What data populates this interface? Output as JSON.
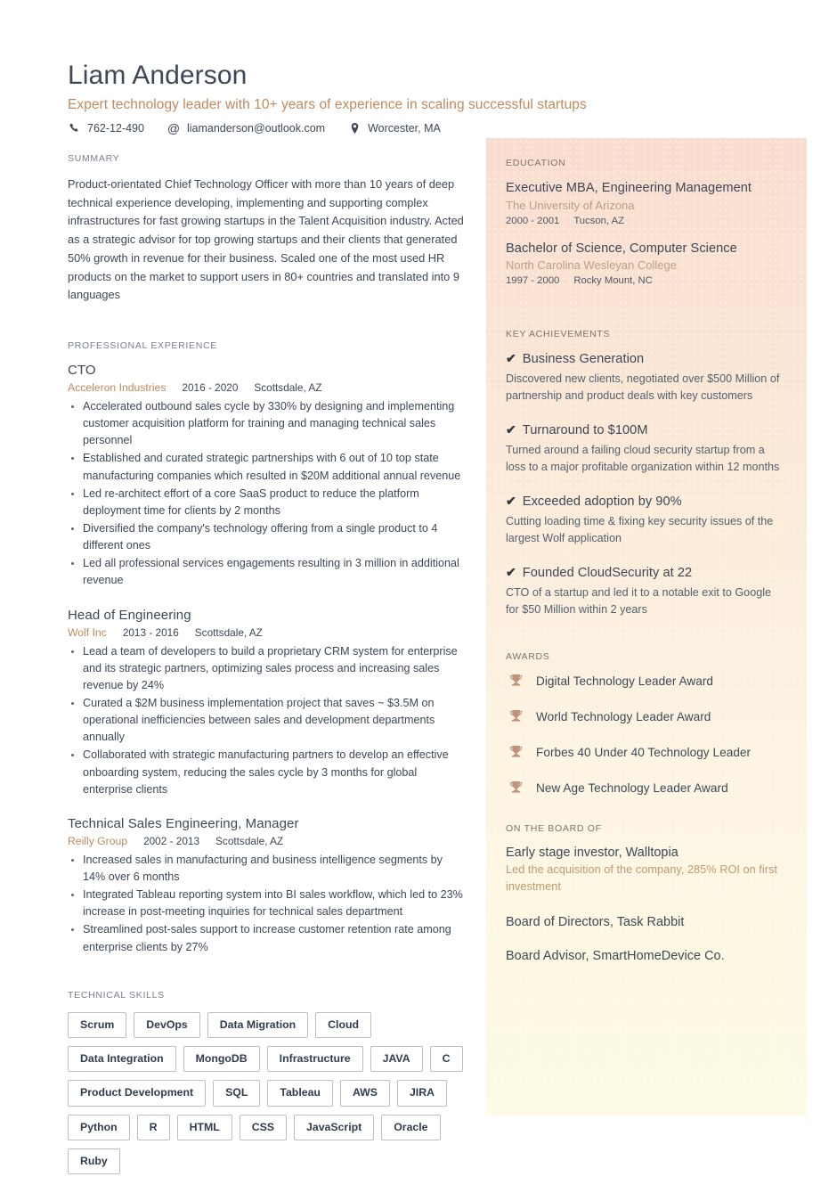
{
  "header": {
    "name": "Liam Anderson",
    "headline": "Expert technology leader with 10+ years of experience in scaling successful startups",
    "contact": {
      "phone": "762-12-490",
      "email": "liamanderson@outlook.com",
      "location": "Worcester, MA",
      "phone_icon": "phone-icon",
      "email_icon": "at-icon",
      "location_icon": "map-pin-icon"
    }
  },
  "colors": {
    "accent": "#c0895f",
    "text": "#3c4858",
    "label": "#78808c",
    "sidebar_top": "#f9ddcf",
    "sidebar_bottom": "#fdfbe3",
    "trophy": "#c2927a"
  },
  "summary": {
    "label": "SUMMARY",
    "text": "Product-orientated Chief Technology Officer with more than 10 years of deep technical experience developing, implementing and supporting complex infrastructures for fast growing startups in the Talent Acquisition industry. Acted as a strategic advisor for top growing startups and their clients that generated 50% growth in revenue for their business. Scaled one of the most used HR products on the market to support users in 80+ countries and translated into 9 languages"
  },
  "experience": {
    "label": "PROFESSIONAL EXPERIENCE",
    "jobs": [
      {
        "title": "CTO",
        "company": "Acceleron Industries",
        "dates": "2016 - 2020",
        "location": "Scottsdale, AZ",
        "bullets": [
          "Accelerated outbound sales cycle by 330% by designing and implementing customer acquisition platform for training and managing technical sales personnel",
          "Established and curated strategic partnerships with 6 out of 10 top state manufacturing companies which resulted in $20M additional annual revenue",
          "Led re-architect effort of a core SaaS product to reduce the platform deployment time for clients by 2 months",
          "Diversified the company's technology offering from a single product to 4 different ones",
          "Led all professional services engagements resulting in 3 million in additional revenue"
        ]
      },
      {
        "title": "Head of Engineering",
        "company": "Wolf Inc",
        "dates": "2013 - 2016",
        "location": "Scottsdale, AZ",
        "bullets": [
          "Lead a team of developers to build a proprietary CRM system for enterprise and its strategic partners, optimizing sales process and increasing sales revenue by 24%",
          "Curated a $2M business implementation project that saves ~ $3.5M on operational inefficiencies between sales and development departments annually",
          "Collaborated with strategic manufacturing partners to develop an effective onboarding system, reducing the sales cycle by 3 months for global enterprise clients"
        ]
      },
      {
        "title": "Technical Sales Engineering, Manager",
        "company": "Reilly Group",
        "dates": "2002 - 2013",
        "location": "Scottsdale, AZ",
        "bullets": [
          "Increased sales in manufacturing and business intelligence segments by 14% over 6 months",
          "Integrated Tableau reporting system into BI sales workflow, which led to 23% increase in post-meeting inquiries for technical sales department",
          "Streamlined post-sales support to increase customer retention rate among enterprise clients by 27%"
        ]
      }
    ]
  },
  "skills": {
    "label": "TECHNICAL SKILLS",
    "items": [
      "Scrum",
      "DevOps",
      "Data Migration",
      "Cloud",
      "Data Integration",
      "MongoDB",
      "Infrastructure",
      "JAVA",
      "C",
      "Product Development",
      "SQL",
      "Tableau",
      "AWS",
      "JIRA",
      "Python",
      "R",
      "HTML",
      "CSS",
      "JavaScript",
      "Oracle",
      "Ruby"
    ]
  },
  "education": {
    "label": "EDUCATION",
    "entries": [
      {
        "degree": "Executive MBA, Engineering Management",
        "school": "The University of Arizona",
        "years": "2000 - 2001",
        "location": "Tucson, AZ"
      },
      {
        "degree": "Bachelor of Science, Computer Science",
        "school": "North Carolina Wesleyan College",
        "years": "1997 - 2000",
        "location": "Rocky Mount, NC"
      }
    ]
  },
  "achievements": {
    "label": "KEY ACHIEVEMENTS",
    "check": "✔",
    "entries": [
      {
        "title": "Business Generation",
        "desc": "Discovered new clients, negotiated over $500 Million of partnership and product deals with key customers"
      },
      {
        "title": "Turnaround to $100M",
        "desc": "Turned around a failing cloud security startup from a loss to a major profitable organization within 12 months"
      },
      {
        "title": "Exceeded adoption by 90%",
        "desc": "Cutting loading time & fixing key security issues of the largest Wolf application"
      },
      {
        "title": "Founded CloudSecurity at 22",
        "desc": "CTO of a startup and led it to a notable exit to Google for $50 Million within 2 years"
      }
    ]
  },
  "awards": {
    "label": "AWARDS",
    "icon": "trophy-icon",
    "entries": [
      "Digital Technology Leader Award",
      "World Technology Leader Award",
      "Forbes 40 Under 40 Technology Leader",
      "New Age Technology Leader Award"
    ]
  },
  "board": {
    "label": "ON THE BOARD OF",
    "entries": [
      {
        "title": "Early stage investor, Walltopia",
        "desc": "Led the acquisition of the company, 285% ROI on first investment"
      },
      {
        "title": "Board of Directors, Task Rabbit",
        "desc": ""
      },
      {
        "title": "Board Advisor, SmartHomeDevice Co.",
        "desc": ""
      }
    ]
  }
}
